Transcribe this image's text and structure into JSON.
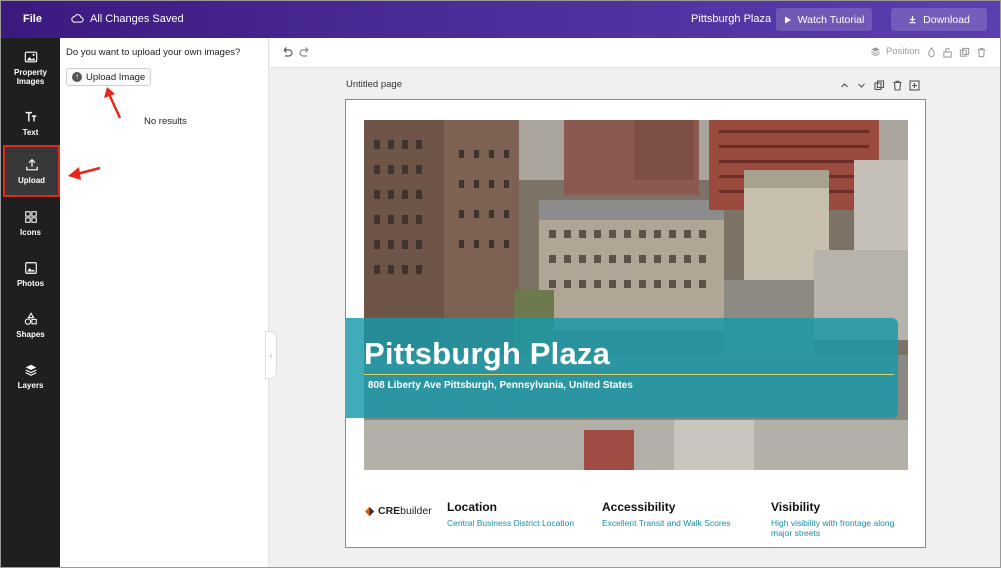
{
  "topbar": {
    "file_label": "File",
    "saved_status": "All Changes Saved",
    "project_name": "Pittsburgh Plaza",
    "watch_tutorial": "Watch Tutorial",
    "download": "Download"
  },
  "rail": {
    "items": [
      {
        "label": "Property Images",
        "icon": "image-icon"
      },
      {
        "label": "Text",
        "icon": "text-icon"
      },
      {
        "label": "Upload",
        "icon": "upload-icon",
        "active": true
      },
      {
        "label": "Icons",
        "icon": "grid-icon"
      },
      {
        "label": "Photos",
        "icon": "photo-icon"
      },
      {
        "label": "Shapes",
        "icon": "shapes-icon"
      },
      {
        "label": "Layers",
        "icon": "layers-icon"
      }
    ]
  },
  "panel": {
    "question": "Do you want to upload your own images?",
    "upload_button": "Upload Image",
    "no_results": "No results"
  },
  "canvas_toolbar": {
    "position_label": "Position"
  },
  "page": {
    "label": "Untitled page",
    "title": "Pittsburgh Plaza",
    "address": "808 Liberty Ave Pittsburgh, Pennsylvania, United States",
    "logo_prefix": "CRE",
    "logo_suffix": "builder",
    "features": [
      {
        "heading": "Location",
        "detail": "Central Business District Location"
      },
      {
        "heading": "Accessibility",
        "detail": "Excellent Transit and Walk Scores"
      },
      {
        "heading": "Visibility",
        "detail": "High visibility with frontage along major streets"
      }
    ]
  },
  "colors": {
    "topbar": "#4a2a95",
    "rail": "#1f1f1f",
    "banner": "#169aaa",
    "accent_blue": "#3fa0e8",
    "highlight_red": "#e0281d"
  }
}
